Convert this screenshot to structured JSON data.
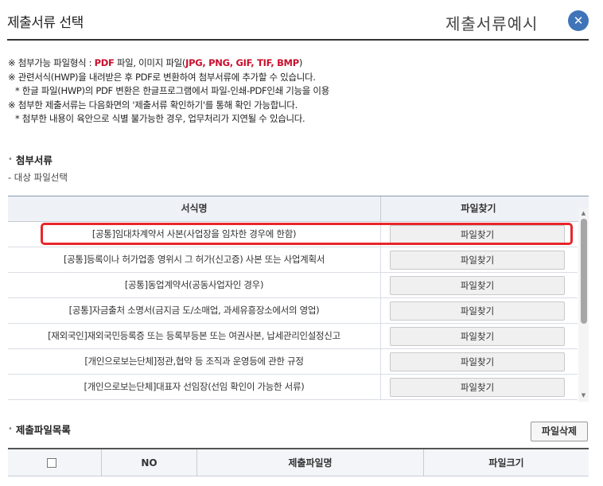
{
  "header": {
    "title": "제출서류 선택",
    "example_link": "제출서류예시",
    "close_symbol": "✕"
  },
  "notices": {
    "line1_prefix": "※ 첨부가능 파일형식 : ",
    "line1_pdf": "PDF",
    "line1_mid": " 파일, 이미지 파일(",
    "line1_formats": "JPG, PNG, GIF, TIF, BMP",
    "line1_suffix": ")",
    "line2": "※ 관련서식(HWP)을 내려받은 후 PDF로 변환하여 첨부서류에 추가할 수 있습니다.",
    "line3": "* 한글 파일(HWP)의 PDF 변환은 한글프로그램에서 파일-인쇄-PDF인쇄 기능을 이용",
    "line4": "※ 첨부한 제출서류는 다음화면의 '제출서류 확인하기'를 통해 확인 가능합니다.",
    "line5": "* 첨부한 내용이 육안으로 식별 불가능한 경우, 업무처리가 지연될 수 있습니다."
  },
  "attach_section": {
    "title": "첨부서류",
    "sub_label": "- 대상 파일선택",
    "columns": {
      "form_name": "서식명",
      "find_file": "파일찾기"
    },
    "rows": [
      {
        "name": "[공통]임대차계약서 사본(사업장을 임차한 경우에 한함)",
        "button": "파일찾기"
      },
      {
        "name": "[공통]등록이나 허가업종 영위시 그 허가(신고증) 사본 또는 사업계획서",
        "button": "파일찾기"
      },
      {
        "name": "[공통]동업계약서(공동사업자인 경우)",
        "button": "파일찾기"
      },
      {
        "name": "[공통]자금출처 소명서(금지금 도/소매업, 과세유흥장소에서의 영업)",
        "button": "파일찾기"
      },
      {
        "name": "[재외국인]재외국민등록증 또는 등록부등본 또는 여권사본, 납세관리인설정신고",
        "button": "파일찾기"
      },
      {
        "name": "[개인으로보는단체]정관,협약 등 조직과 운영등에 관한 규정",
        "button": "파일찾기"
      },
      {
        "name": "[개인으로보는단체]대표자 선임장(선임 확인이 가능한 서류)",
        "button": "파일찾기"
      }
    ]
  },
  "file_section": {
    "title": "제출파일목록",
    "delete_button": "파일삭제",
    "columns": {
      "no": "NO",
      "file_name": "제출파일명",
      "file_size": "파일크기"
    }
  },
  "colors": {
    "accent": "#3f74b8",
    "highlight": "#e8262b",
    "emphasis": "#c8102e"
  }
}
